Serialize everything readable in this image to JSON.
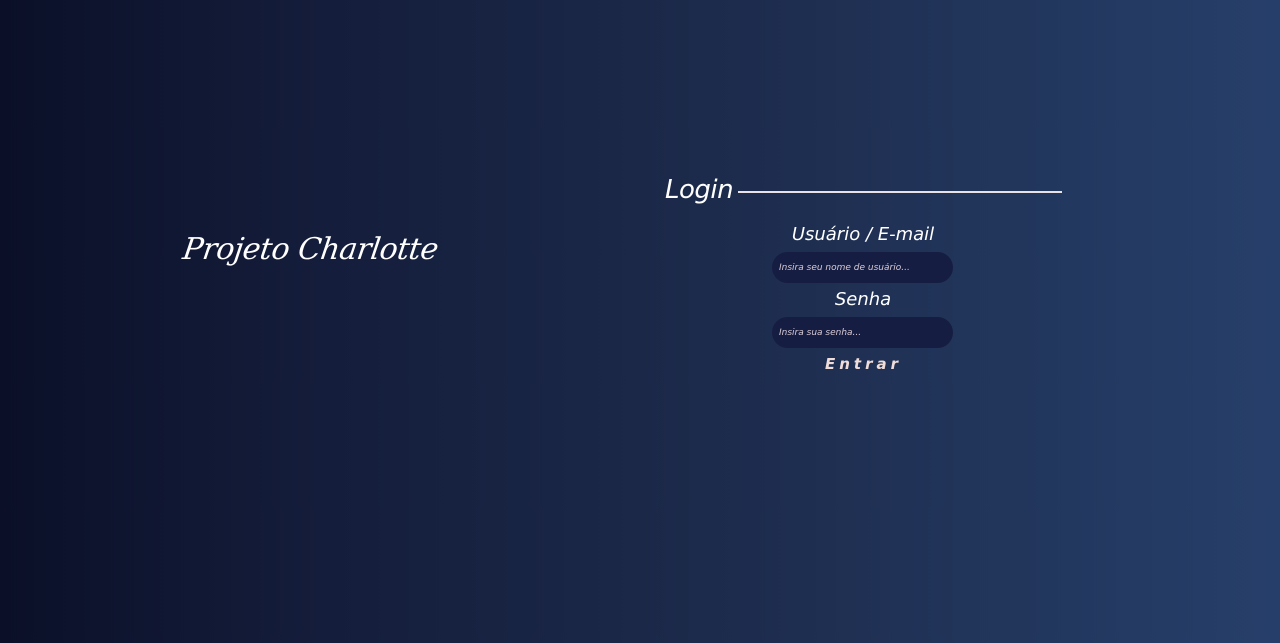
{
  "brand": {
    "name": "Projeto Charlotte"
  },
  "login": {
    "title": "Login",
    "username": {
      "label": "Usuário / E-mail",
      "placeholder": "Insira seu nome de usuário...",
      "value": ""
    },
    "password": {
      "label": "Senha",
      "placeholder": "Insira sua senha...",
      "value": ""
    },
    "submit_label": "Entrar"
  },
  "colors": {
    "background_left": "#0b1028",
    "background_right": "#263f6a",
    "input_background": "#161d42",
    "placeholder_text": "#d8cbd6",
    "submit_text": "#f0dcd8",
    "rule": "#e8e1e6"
  }
}
